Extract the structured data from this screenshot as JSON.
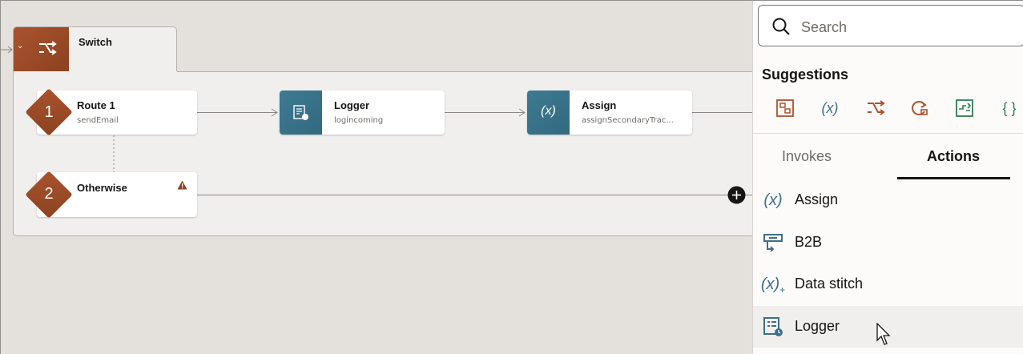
{
  "switch": {
    "title": "Switch",
    "collapse_icon": "chevron-down-icon",
    "icon": "switch-icon"
  },
  "routes": [
    {
      "number": "1",
      "title": "Route 1",
      "subtitle": "sendEmail"
    },
    {
      "number": "2",
      "title": "Otherwise",
      "warning_icon": "warning-icon"
    }
  ],
  "nodes": [
    {
      "title": "Logger",
      "subtitle": "logincoming",
      "icon": "logger-icon"
    },
    {
      "title": "Assign",
      "subtitle": "assignSecondaryTrac...",
      "icon_text": "(x)"
    }
  ],
  "panel": {
    "search": {
      "placeholder": "Search",
      "icon": "search-icon"
    },
    "suggestions_title": "Suggestions",
    "suggestion_icons": [
      "map-icon",
      "assign-icon",
      "switch-icon",
      "loop-icon",
      "stage-file-icon",
      "json-icon"
    ],
    "tabs": [
      {
        "label": "Invokes",
        "active": false
      },
      {
        "label": "Actions",
        "active": true
      }
    ],
    "actions": [
      {
        "label": "Assign",
        "icon": "assign-icon"
      },
      {
        "label": "B2B",
        "icon": "b2b-icon"
      },
      {
        "label": "Data stitch",
        "icon": "data-stitch-icon"
      },
      {
        "label": "Logger",
        "icon": "logger-icon"
      }
    ]
  },
  "colors": {
    "brand_brown": "#a9532e",
    "teal": "#3f7a90",
    "action_blue": "#3d6f88",
    "suggest_green": "#2e7d4f"
  }
}
